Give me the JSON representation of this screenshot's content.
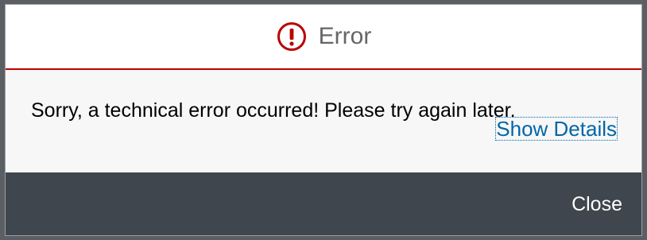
{
  "dialog": {
    "title": "Error",
    "message": "Sorry, a technical error occurred! Please try again later.",
    "details_link": "Show Details",
    "close_label": "Close",
    "icon": "error-circle-icon",
    "colors": {
      "accent": "#bb0000",
      "link": "#0066a8",
      "footer": "#3f464d"
    }
  }
}
